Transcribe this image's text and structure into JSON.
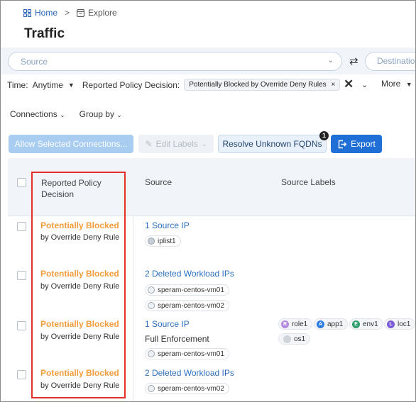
{
  "breadcrumb": {
    "home": "Home",
    "separator": ">",
    "current": "Explore"
  },
  "page_title": "Traffic",
  "filters": {
    "source_placeholder": "Source",
    "destination_placeholder": "Destination",
    "time_label": "Time:",
    "time_value": "Anytime",
    "decision_label": "Reported Policy Decision:",
    "decision_chip": "Potentially Blocked by Override Deny Rules",
    "chip_remove": "×",
    "clear": "✕",
    "more_label": "More"
  },
  "options": {
    "connections": "Connections",
    "group_by": "Group by"
  },
  "toolbar": {
    "allow_label": "Allow Selected Connections...",
    "edit_labels": "Edit Labels",
    "resolve_label": "Resolve Unknown FQDNs",
    "resolve_badge": "1",
    "export_label": "Export"
  },
  "table": {
    "headers": {
      "decision_line1": "Reported Policy",
      "decision_line2": "Decision",
      "source": "Source",
      "source_labels": "Source Labels"
    },
    "rows": [
      {
        "decision": "Potentially Blocked",
        "rule": "by Override Deny Rule",
        "source": "1 Source IP",
        "enforcement": "",
        "tags": [
          "iplist1"
        ],
        "labels": []
      },
      {
        "decision": "Potentially Blocked",
        "rule": "by Override Deny Rule",
        "source": "2 Deleted Workload IPs",
        "enforcement": "",
        "tags": [
          "speram-centos-vm01",
          "speram-centos-vm02"
        ],
        "labels": []
      },
      {
        "decision": "Potentially Blocked",
        "rule": "by Override Deny Rule",
        "source": "1 Source IP",
        "enforcement": "Full Enforcement",
        "tags": [
          "speram-centos-vm01"
        ],
        "labels": [
          "role1",
          "app1",
          "env1",
          "loc1",
          "os1"
        ]
      },
      {
        "decision": "Potentially Blocked",
        "rule": "by Override Deny Rule",
        "source": "2 Deleted Workload IPs",
        "enforcement": "",
        "tags": [
          "speram-centos-vm02"
        ],
        "labels": []
      }
    ]
  },
  "colors": {
    "accent": "#1f6fd6",
    "blocked": "#f39c3c",
    "highlight_box": "#e0312b"
  }
}
